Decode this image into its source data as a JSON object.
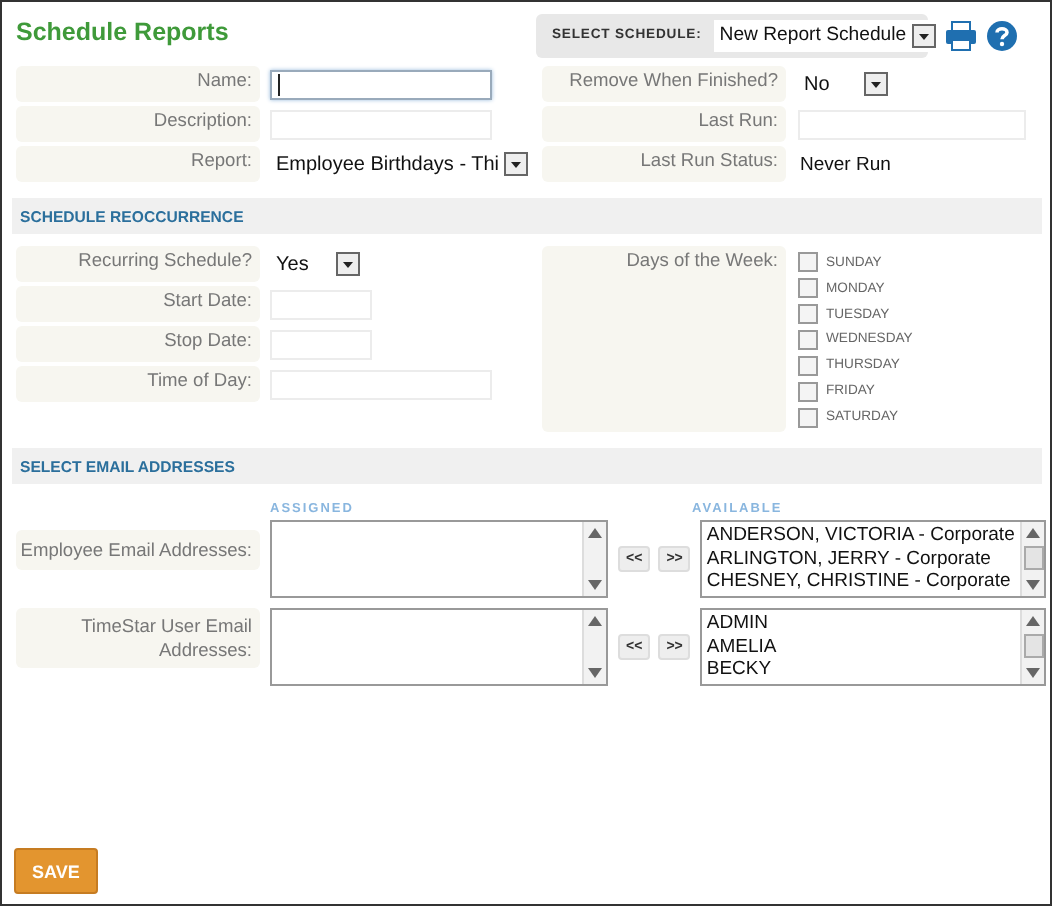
{
  "title": "Schedule Reports",
  "schedule_select": {
    "label": "SELECT SCHEDULE:",
    "value": "New Report Schedule"
  },
  "details": {
    "left": [
      {
        "label": "Name:",
        "kind": "text",
        "focused": true
      },
      {
        "label": "Description:",
        "kind": "text",
        "focused": false
      },
      {
        "label": "Report:",
        "kind": "select",
        "value": "Employee Birthdays - Thi"
      }
    ],
    "right": [
      {
        "label": "Remove When Finished?",
        "kind": "select",
        "value": "No"
      },
      {
        "label": "Last Run:",
        "kind": "text",
        "focused": false
      },
      {
        "label": "Last Run Status:",
        "kind": "static",
        "value": "Never Run"
      }
    ]
  },
  "recurrence": {
    "title": "SCHEDULE REOCCURRENCE",
    "fields": [
      {
        "label": "Recurring Schedule?",
        "kind": "select",
        "value": "Yes"
      },
      {
        "label": "Start Date:",
        "kind": "date",
        "focused": false
      },
      {
        "label": "Stop Date:",
        "kind": "date",
        "focused": false
      },
      {
        "label": "Time of Day:",
        "kind": "text",
        "focused": false
      }
    ],
    "days": {
      "label": "Days of the Week:",
      "items": [
        {
          "label": "SUNDAY",
          "checked": false
        },
        {
          "label": "MONDAY",
          "checked": false
        },
        {
          "label": "TUESDAY",
          "checked": false
        },
        {
          "label": "WEDNESDAY",
          "checked": false
        },
        {
          "label": "THURSDAY",
          "checked": false
        },
        {
          "label": "FRIDAY",
          "checked": false
        },
        {
          "label": "SATURDAY",
          "checked": false
        }
      ]
    }
  },
  "emails": {
    "title": "SELECT EMAIL ADDRESSES",
    "assigned_heading": "ASSIGNED",
    "available_heading": "AVAILABLE",
    "rows": [
      {
        "label": "Employee Email Addresses:",
        "buttons": [
          "<<",
          ">>"
        ],
        "available": [
          "ANDERSON, VICTORIA - Corporate",
          "ARLINGTON, JERRY - Corporate",
          "CHESNEY, CHRISTINE - Corporate"
        ]
      },
      {
        "label": "TimeStar User Email Addresses:",
        "buttons": [
          "<<",
          ">>"
        ],
        "available": [
          "ADMIN",
          "AMELIA",
          "BECKY"
        ]
      }
    ]
  },
  "save_button": "SAVE"
}
